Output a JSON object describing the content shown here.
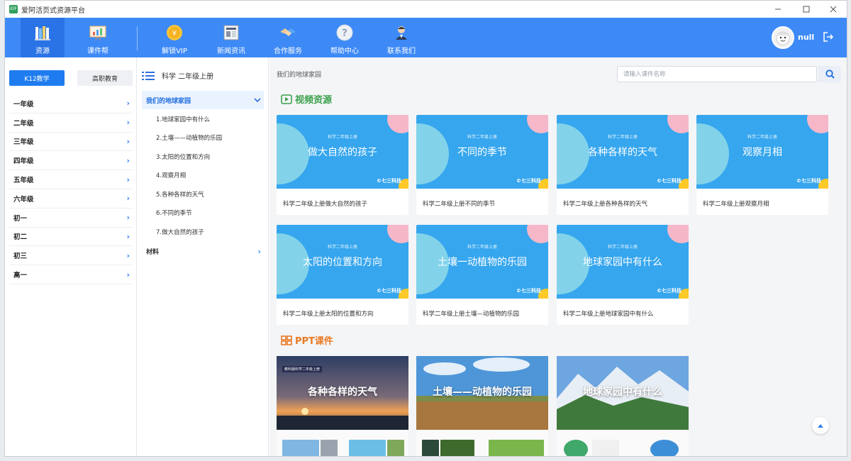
{
  "window": {
    "title": "爱阿活页式资源平台",
    "app_icon": "iDF"
  },
  "nav": {
    "items": [
      {
        "label": "资源",
        "icon": "books-icon"
      },
      {
        "label": "课件帮",
        "icon": "presentation-board-icon"
      },
      {
        "label": "解锁VIP",
        "icon": "vip-coin-icon"
      },
      {
        "label": "新闻资讯",
        "icon": "newspaper-icon"
      },
      {
        "label": "合作服务",
        "icon": "handshake-icon"
      },
      {
        "label": "帮助中心",
        "icon": "help-icon"
      },
      {
        "label": "联系我们",
        "icon": "customer-service-icon"
      }
    ],
    "active": "资源",
    "user": "null"
  },
  "sidebar": {
    "tabs": [
      "K12教学",
      "高职教育"
    ],
    "active_tab": "K12教学",
    "grades": [
      "一年级",
      "二年级",
      "三年级",
      "四年级",
      "五年级",
      "六年级",
      "初一",
      "初二",
      "初三",
      "高一"
    ]
  },
  "mid": {
    "title": "科学 二年级上册",
    "open_unit": "我们的地球家园",
    "lessons": [
      "1.地球家园中有什么",
      "2.土壤——动植物的乐园",
      "3.太阳的位置和方向",
      "4.观察月相",
      "5.各种各样的天气",
      "6.不同的季节",
      "7.做大自然的孩子"
    ],
    "closed_unit": "材料"
  },
  "content": {
    "breadcrumb": "我们的地球家园",
    "search_placeholder": "请输入课件名称",
    "video_section": "视频资源",
    "ppt_section": "PPT课件",
    "video_cards": [
      {
        "sub": "科学二年级上册",
        "title": "做大自然的孩子",
        "caption": "科学二年级上册做大自然的孩子",
        "logo": "©七三科技"
      },
      {
        "sub": "科学二年级上册",
        "title": "不同的季节",
        "caption": "科学二年级上册不同的季节",
        "logo": "©七三科技"
      },
      {
        "sub": "科学二年级上册",
        "title": "各种各样的天气",
        "caption": "科学二年级上册各种各样的天气",
        "logo": "©七三科技"
      },
      {
        "sub": "科学二年级上册",
        "title": "观察月相",
        "caption": "科学二年级上册观察月相",
        "logo": "©七三科技"
      },
      {
        "sub": "科学二年级上册",
        "title": "太阳的位置和方向",
        "caption": "科学二年级上册太阳的位置和方向",
        "logo": "©七三科技"
      },
      {
        "sub": "科学二年级上册",
        "title": "土壤一动植物的乐园",
        "caption": "科学二年级上册土壤—动植物的乐园",
        "logo": "©七三科技"
      },
      {
        "sub": "科学二年级上册",
        "title": "地球家园中有什么",
        "caption": "科学二年级上册地球家园中有什么",
        "logo": "©七三科技"
      }
    ],
    "ppt_cards": [
      {
        "sub": "教科版科学二年级上册",
        "title": "各种各样的天气"
      },
      {
        "sub": "",
        "title": "土壤——动植物的乐园"
      },
      {
        "sub": "",
        "title": "地球家园中有什么"
      }
    ],
    "colors": {
      "accent": "#3d8af7",
      "video": "#3aa14a",
      "ppt": "#e97a23"
    }
  }
}
